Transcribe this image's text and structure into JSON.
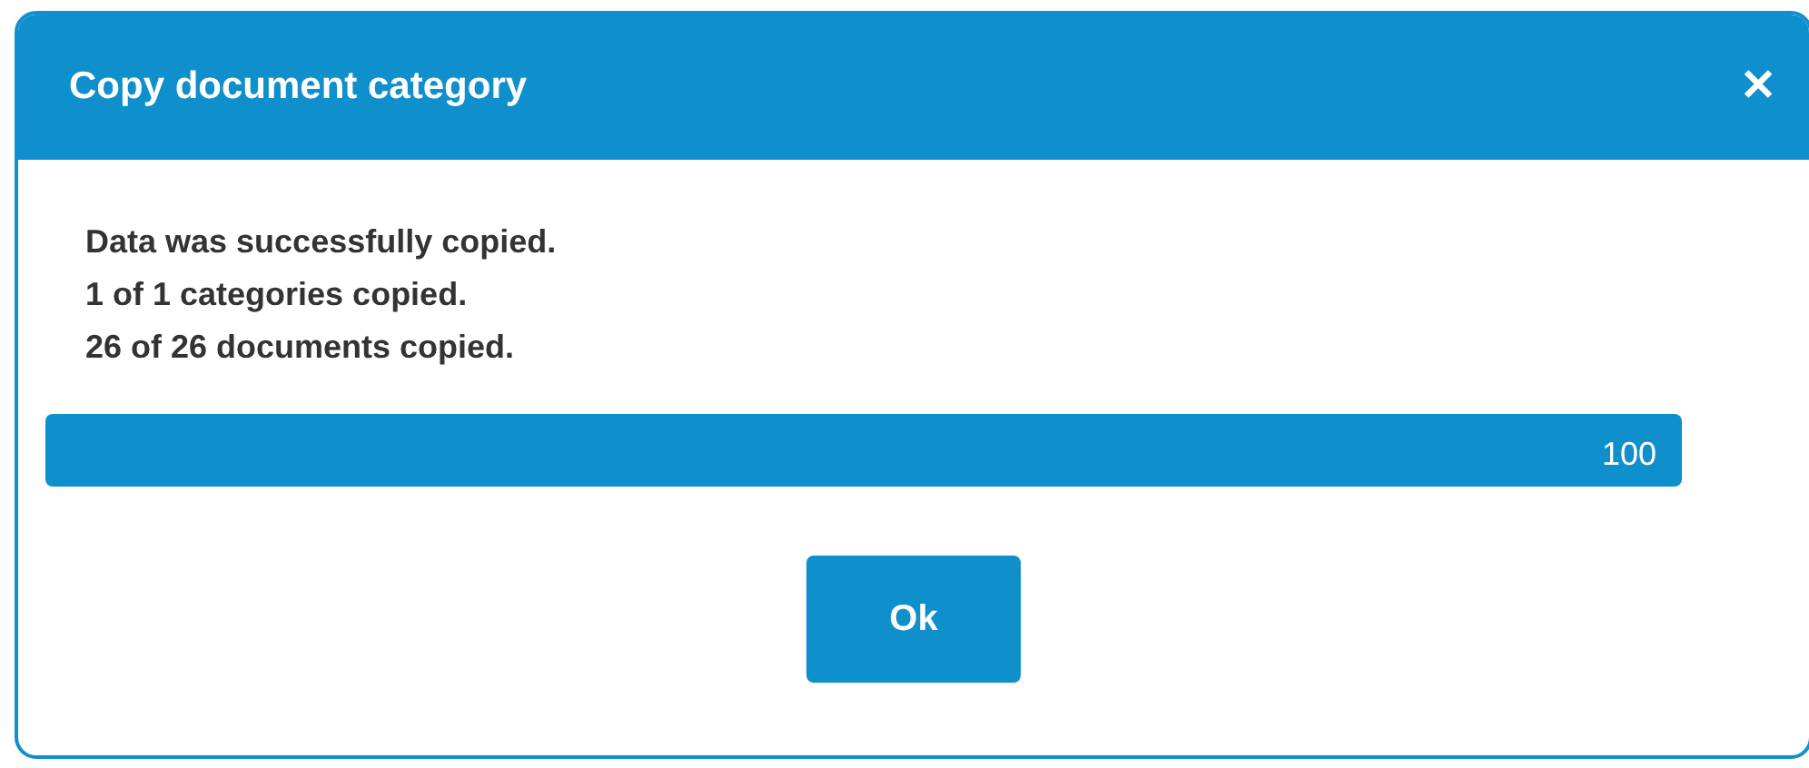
{
  "dialog": {
    "title": "Copy document category",
    "close": "✕",
    "messages": [
      "Data was successfully copied.",
      "1 of 1 categories copied.",
      "26 of 26 documents copied."
    ],
    "progress": {
      "level": 1,
      "reading": "100"
    },
    "buttons": [
      "Ok"
    ]
  }
}
